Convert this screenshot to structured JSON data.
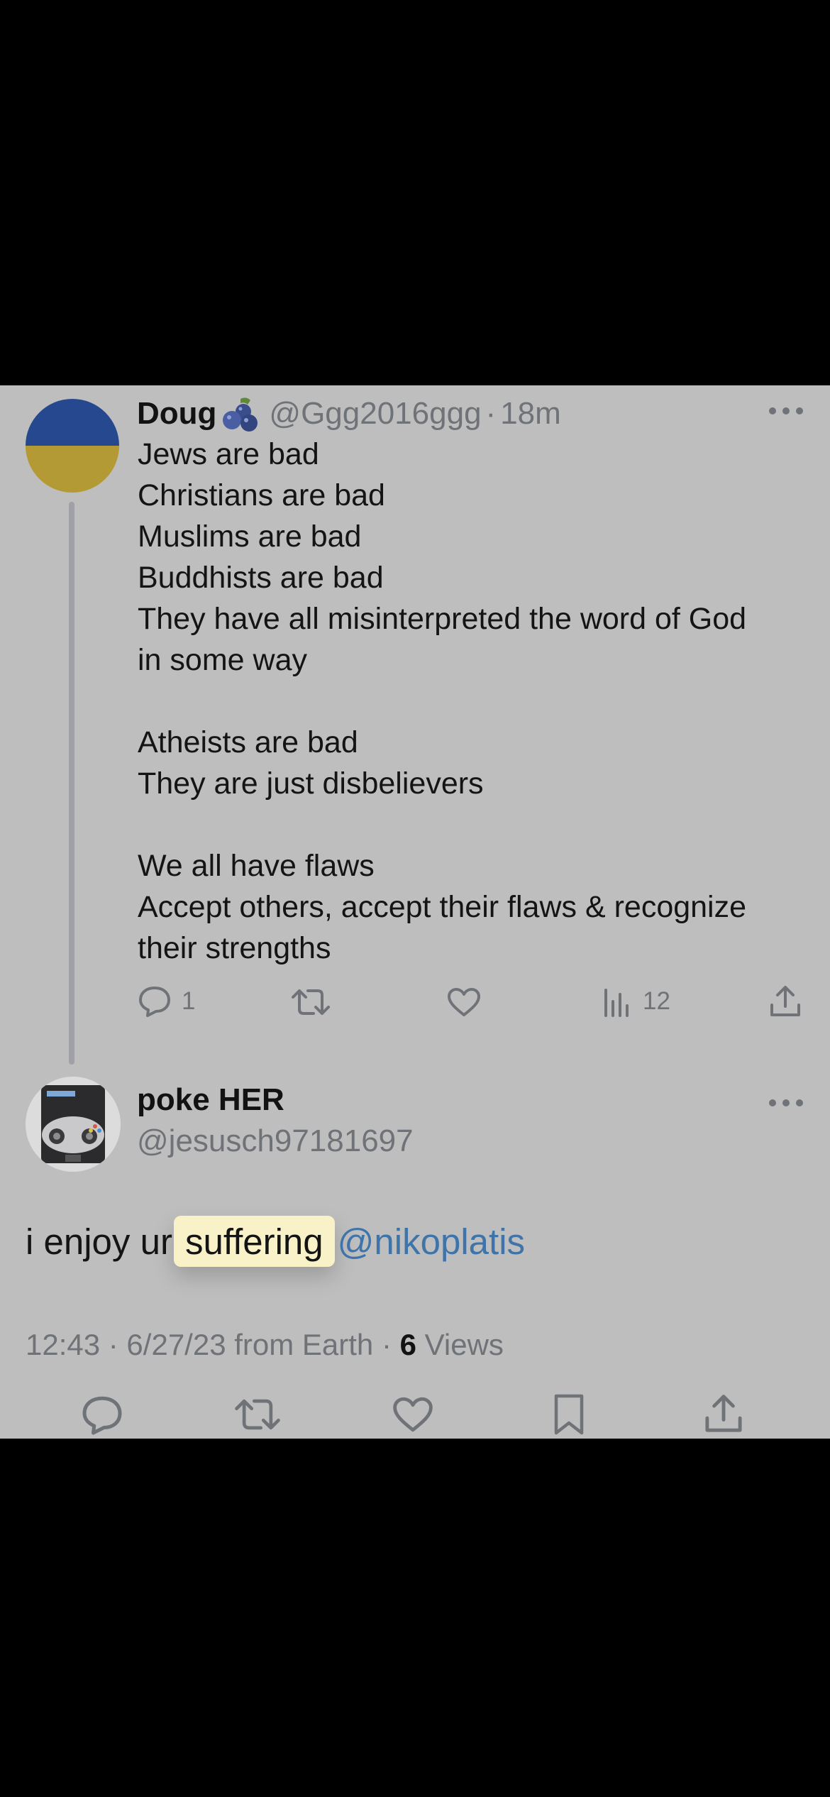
{
  "parent_tweet": {
    "author_name": "Doug",
    "handle": "@Ggg2016ggg",
    "separator": "·",
    "age": "18m",
    "lines": [
      "Jews are bad",
      "Christians are bad",
      "Muslims are bad",
      "Buddhists are bad",
      "They have all misinterpreted the word of God",
      "in some way",
      "",
      "Atheists are bad",
      "They are just disbelievers",
      "",
      "We all have flaws",
      "Accept others, accept their flaws & recognize",
      "their strengths"
    ],
    "reply_count": "1",
    "view_count": "12"
  },
  "reply_tweet": {
    "author_name": "poke HER",
    "handle": "@jesusch97181697",
    "text_before": "i enjoy ur",
    "highlighted_word": "suffering",
    "mention": "@nikoplatis",
    "timestamp": "12:43 · 6/27/23 from Earth · ",
    "views_count": "6",
    "views_label": " Views"
  },
  "colors": {
    "background": "#bebebe",
    "mention": "#3e74a9",
    "icon": "#6f7378",
    "highlight": "#f9f2c8"
  },
  "icons": [
    "reply-icon",
    "retweet-icon",
    "like-icon",
    "views-icon",
    "share-icon",
    "bookmark-icon",
    "more-icon"
  ]
}
